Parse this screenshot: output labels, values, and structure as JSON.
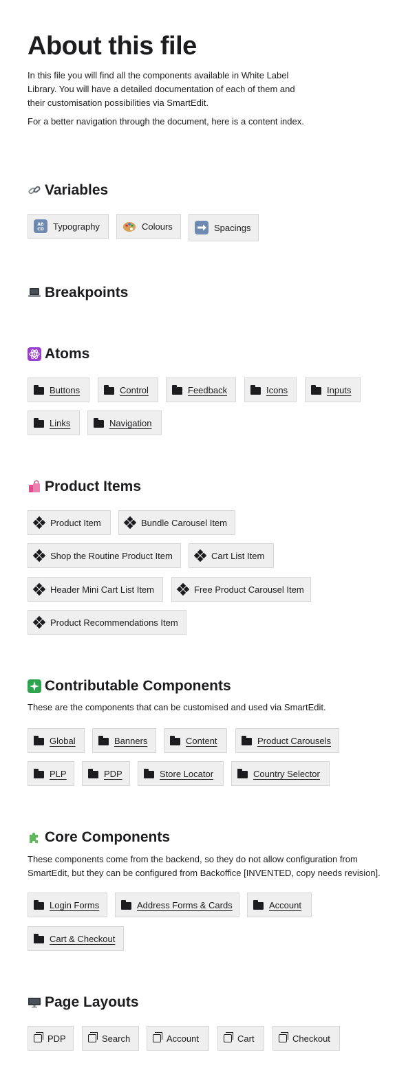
{
  "title": "About this file",
  "intro": [
    "In this file you will find all the components available in White Label Library. You will have a detailed documentation of each of them and their customisation possibilities via SmartEdit.",
    "For a better navigation through the document, here is a content index."
  ],
  "sections": {
    "variables": {
      "title": "Variables",
      "icon": "link-icon",
      "items": [
        {
          "label": "Typography",
          "icon": "abcd-icon"
        },
        {
          "label": "Colours",
          "icon": "palette-icon"
        },
        {
          "label": "Spacings",
          "icon": "right-arrow-icon"
        }
      ]
    },
    "breakpoints": {
      "title": "Breakpoints",
      "icon": "laptop-icon"
    },
    "atoms": {
      "title": "Atoms",
      "icon": "atom-icon",
      "items": [
        {
          "label": "Buttons",
          "icon": "folder-icon"
        },
        {
          "label": "Control",
          "icon": "folder-icon"
        },
        {
          "label": "Feedback",
          "icon": "folder-icon"
        },
        {
          "label": "Icons",
          "icon": "folder-icon"
        },
        {
          "label": "Inputs",
          "icon": "folder-icon"
        },
        {
          "label": "Links",
          "icon": "folder-icon"
        },
        {
          "label": "Navigation",
          "icon": "folder-icon"
        }
      ]
    },
    "product_items": {
      "title": "Product Items",
      "icon": "shopping-bags-icon",
      "items": [
        {
          "label": "Product Item",
          "icon": "component-icon"
        },
        {
          "label": "Bundle Carousel Item",
          "icon": "component-icon"
        },
        {
          "label": "Shop the Routine Product Item",
          "icon": "component-icon"
        },
        {
          "label": "Cart List Item",
          "icon": "component-icon"
        },
        {
          "label": "Header Mini Cart List Item",
          "icon": "component-icon"
        },
        {
          "label": "Free Product Carousel Item",
          "icon": "component-icon"
        },
        {
          "label": "Product Recommendations Item",
          "icon": "component-icon"
        }
      ]
    },
    "contributable": {
      "title": "Contributable Components",
      "icon": "sparkles-icon",
      "description": "These are the components that can be customised and used via SmartEdit.",
      "items": [
        {
          "label": "Global",
          "icon": "folder-icon"
        },
        {
          "label": "Banners",
          "icon": "folder-icon"
        },
        {
          "label": "Content",
          "icon": "folder-icon"
        },
        {
          "label": "Product Carousels",
          "icon": "folder-icon"
        },
        {
          "label": "PLP",
          "icon": "folder-icon"
        },
        {
          "label": "PDP",
          "icon": "folder-icon"
        },
        {
          "label": "Store Locator",
          "icon": "folder-icon"
        },
        {
          "label": "Country Selector",
          "icon": "folder-icon"
        }
      ]
    },
    "core": {
      "title": "Core Components",
      "icon": "puzzle-icon",
      "description": "These components come from the backend, so they do not allow configuration from SmartEdit, but they can be configured from Backoffice [INVENTED, copy needs revision].",
      "items": [
        {
          "label": "Login Forms",
          "icon": "folder-icon"
        },
        {
          "label": "Address Forms & Cards",
          "icon": "folder-icon"
        },
        {
          "label": "Account",
          "icon": "folder-icon"
        },
        {
          "label": "Cart & Checkout",
          "icon": "folder-icon"
        }
      ]
    },
    "page_layouts": {
      "title": "Page Layouts",
      "icon": "desktop-icon",
      "items": [
        {
          "label": "PDP",
          "icon": "page-icon"
        },
        {
          "label": "Search",
          "icon": "page-icon"
        },
        {
          "label": "Account",
          "icon": "page-icon"
        },
        {
          "label": "Cart",
          "icon": "page-icon"
        },
        {
          "label": "Checkout",
          "icon": "page-icon"
        }
      ]
    }
  }
}
